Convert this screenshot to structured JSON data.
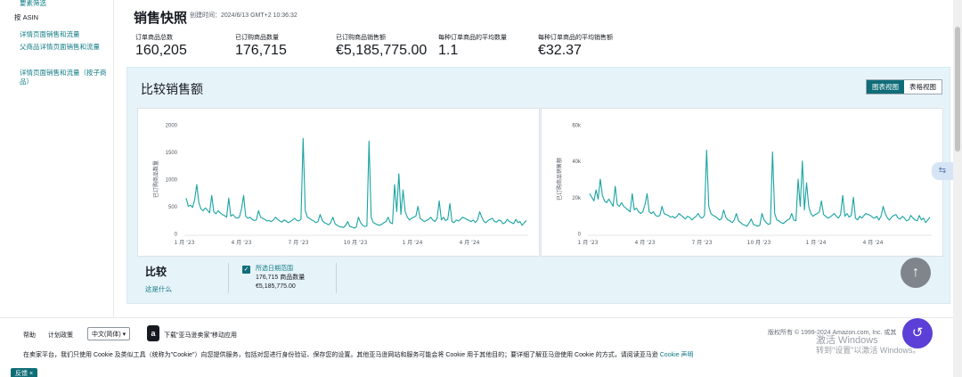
{
  "sidebar": {
    "top_link": "要素筛选",
    "section_label": "按 ASIN",
    "links": [
      "详情页面销售和流量",
      "父商品详情页面销售和流量",
      "详情页面销售和流量（按子商品）"
    ]
  },
  "header": {
    "title": "销售快照",
    "created": "创建时间：2024/6/13 GMT+2 10:36:32"
  },
  "metrics": [
    {
      "label": "订单商品总数",
      "value": "160,205"
    },
    {
      "label": "已订购商品数量",
      "value": "176,715"
    },
    {
      "label": "已订购商品销售额",
      "value": "€5,185,775.00"
    },
    {
      "label": "每种订单商品的平均数量",
      "value": "1.1"
    },
    {
      "label": "每种订单商品的平均销售额",
      "value": "€32.37"
    }
  ],
  "panel": {
    "title": "比较销售额",
    "toggle": {
      "chart_label": "图表视图",
      "table_label": "表格视图",
      "selected": "图表视图"
    }
  },
  "colors": {
    "accent": "#0f6d78",
    "series": "#1aa3a3",
    "link": "#0f7b85"
  },
  "chart_data": [
    {
      "type": "line",
      "ylabel": "已订购商品数量",
      "yticks": [
        "0",
        "500",
        "1000",
        "1500",
        "2000"
      ],
      "ylim": [
        0,
        2000
      ],
      "xticks": [
        "1 月 '23",
        "4 月 '23",
        "7 月 '23",
        "10 月 '23",
        "1 月 '24",
        "4 月 '24"
      ],
      "grid": false,
      "series": [
        {
          "values": [
            650,
            500,
            520,
            480,
            620,
            900,
            560,
            450,
            420,
            470,
            430,
            380,
            700,
            400,
            360,
            420,
            380,
            350,
            330,
            300,
            650,
            320,
            350,
            300,
            280,
            300,
            450,
            700,
            320,
            280,
            300,
            260,
            240,
            250,
            420,
            300,
            280,
            260,
            230,
            240,
            220,
            250,
            300,
            260,
            230,
            210,
            250,
            230,
            200,
            220,
            250,
            280,
            240,
            230,
            260,
            1750,
            420,
            300,
            280,
            250,
            230,
            200,
            220,
            350,
            240,
            200,
            180,
            160,
            200,
            300,
            180,
            150,
            130,
            120,
            110,
            150,
            220,
            130,
            120,
            100,
            120,
            300,
            200,
            150,
            130,
            140,
            1700,
            300,
            200,
            180,
            160,
            150,
            170,
            200,
            220,
            300,
            200,
            180,
            900,
            400,
            1100,
            350,
            800,
            400,
            300,
            250,
            280,
            300,
            320,
            500,
            280,
            250,
            220,
            240,
            260,
            300,
            250,
            220,
            280,
            600,
            250,
            300,
            240,
            260,
            550,
            220,
            200,
            250,
            230,
            260,
            300,
            280,
            260,
            240,
            220,
            250,
            200,
            250,
            400,
            300,
            220,
            200,
            240,
            260,
            280,
            220,
            210,
            250,
            230,
            180,
            200,
            260,
            220,
            200,
            180,
            260,
            200,
            220,
            150,
            200,
            240
          ]
        }
      ]
    },
    {
      "type": "line",
      "ylabel": "已订购商品销售额",
      "yticks": [
        "0",
        "20k",
        "40k",
        "60k"
      ],
      "ylim": [
        0,
        60000
      ],
      "xticks": [
        "1 月 '23",
        "4 月 '23",
        "7 月 '23",
        "10 月 '23",
        "1 月 '24",
        "4 月 '24"
      ],
      "grid": false,
      "series": [
        {
          "values": [
            22000,
            20000,
            18000,
            24000,
            19000,
            30000,
            21000,
            18000,
            17000,
            19000,
            17000,
            15000,
            26000,
            16000,
            15000,
            17000,
            15000,
            14000,
            13000,
            12000,
            22000,
            13000,
            14000,
            12000,
            11000,
            12000,
            16000,
            22000,
            12000,
            11000,
            12000,
            10000,
            9500,
            10000,
            15000,
            11000,
            10500,
            10000,
            9000,
            9500,
            8500,
            9500,
            11000,
            10000,
            9000,
            8000,
            9500,
            9000,
            7500,
            8500,
            9500,
            11000,
            9000,
            8500,
            10000,
            46000,
            15000,
            11000,
            10000,
            9500,
            8500,
            7500,
            8000,
            13000,
            9000,
            7500,
            7000,
            6000,
            7500,
            11000,
            7000,
            6000,
            5000,
            4500,
            4000,
            6000,
            8000,
            5000,
            4500,
            4000,
            4500,
            11000,
            7500,
            6000,
            5000,
            5500,
            45000,
            11000,
            7500,
            7000,
            6000,
            5500,
            6500,
            7500,
            8000,
            11000,
            7500,
            7000,
            30000,
            15000,
            40000,
            13000,
            28000,
            15000,
            11000,
            9500,
            10500,
            11000,
            12000,
            18000,
            10500,
            9500,
            8500,
            9000,
            10000,
            11000,
            9500,
            8500,
            10500,
            21000,
            9500,
            11000,
            9000,
            10000,
            20000,
            8500,
            7500,
            9500,
            8500,
            10000,
            11000,
            10500,
            10000,
            9000,
            8500,
            9500,
            7500,
            9500,
            15000,
            11000,
            8500,
            7500,
            9000,
            10000,
            10500,
            8500,
            8000,
            9500,
            8500,
            7000,
            7500,
            10000,
            8500,
            7500,
            7000,
            10000,
            7500,
            8500,
            6000,
            7500,
            9000
          ]
        }
      ]
    }
  ],
  "compare": {
    "title": "比较",
    "help": "这是什么",
    "item_name": "所选日期范围",
    "item_units": "176,715 商品数量",
    "item_sales": "€5,185,775.00"
  },
  "footer": {
    "help": "帮助",
    "policies": "计划政策",
    "language": "中文(简体) ▾",
    "app_text": "下载\"亚马逊卖家\"移动应用",
    "copyright": "版权所有 © 1999-2024 Amazon.com, Inc. 或其",
    "cookie_text": "在卖家平台，我们只使用 Cookie 及类似工具（统称为\"Cookie\"）向您提供服务，包括对您进行身份验证、保存您的设置。其他亚马逊网站和服务可能会将 Cookie 用于其他目的；要详细了解亚马逊使用 Cookie 的方式，请阅读亚马逊",
    "cookie_link": "Cookie 声明",
    "feedback": "反馈 ×"
  },
  "watermark": {
    "line1": "激活 Windows",
    "line2": "转到\"设置\"以激活 Windows。"
  }
}
